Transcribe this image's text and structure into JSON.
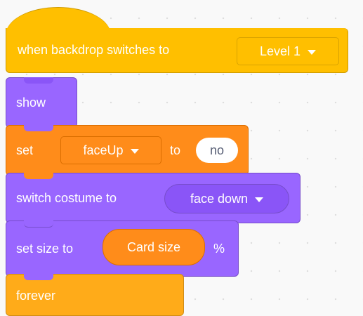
{
  "blocks": {
    "when_backdrop": {
      "label": "when backdrop switches to",
      "dropdown_value": "Level 1",
      "dropdown_icon": "caret-down-icon",
      "category": "events",
      "color": "#FFBF00"
    },
    "show": {
      "label": "show",
      "category": "looks",
      "color": "#9966FF"
    },
    "set_variable": {
      "label": "set",
      "variable": "faceUp",
      "variable_icon": "caret-down-icon",
      "to_label": "to",
      "value": "no",
      "category": "variables",
      "color": "#FF8C1A"
    },
    "switch_costume": {
      "label": "switch costume to",
      "costume": "face down",
      "costume_icon": "caret-down-icon",
      "category": "looks",
      "color": "#9966FF"
    },
    "set_size": {
      "label": "set size to",
      "value": "Card size",
      "unit": "%",
      "category": "looks",
      "color": "#9966FF"
    },
    "forever": {
      "label": "forever",
      "category": "control",
      "color": "#FFAB19"
    }
  }
}
